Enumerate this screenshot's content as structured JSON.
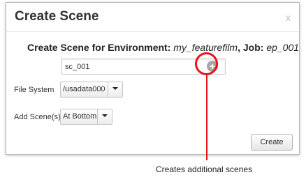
{
  "dialog": {
    "title": "Create Scene",
    "close_label": "x",
    "heading": {
      "prefix": "Create Scene for Environment: ",
      "environment": "my_featurefilm",
      "job_prefix": ", Job: ",
      "job": "ep_001"
    },
    "scene_name_value": "sc_001",
    "add_icon": "plus-circle-icon",
    "file_system": {
      "label": "File System",
      "selected": "/usadata000"
    },
    "add_scenes": {
      "label": "Add Scene(s)",
      "selected": "At Bottom"
    },
    "create_label": "Create"
  },
  "annotation": {
    "text": "Creates additional scenes",
    "color": "#e8141b"
  }
}
